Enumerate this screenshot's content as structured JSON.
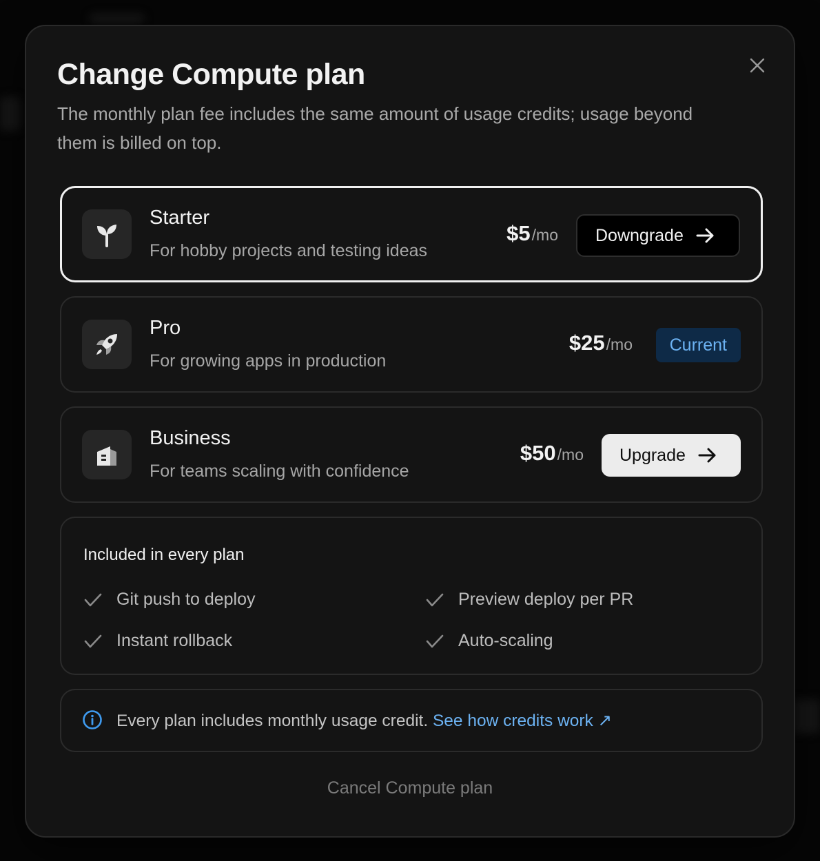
{
  "modal": {
    "title": "Change Compute plan",
    "subtitle": "The monthly plan fee includes the same amount of usage credits; usage beyond them is billed on top."
  },
  "plans": [
    {
      "name": "Starter",
      "description": "For hobby projects and testing ideas",
      "price": "$5",
      "period": "/mo",
      "action": "Downgrade",
      "icon": "sprout-icon",
      "selected": true
    },
    {
      "name": "Pro",
      "description": "For growing apps in production",
      "price": "$25",
      "period": "/mo",
      "action": "Current",
      "icon": "rocket-icon",
      "selected": false
    },
    {
      "name": "Business",
      "description": "For teams scaling with confidence",
      "price": "$50",
      "period": "/mo",
      "action": "Upgrade",
      "icon": "building-icon",
      "selected": false
    }
  ],
  "features": {
    "title": "Included in every plan",
    "items": [
      "Git push to deploy",
      "Preview deploy per PR",
      "Instant rollback",
      "Auto-scaling"
    ]
  },
  "info": {
    "text": "Every plan includes monthly usage credit.",
    "link": "See how credits work ↗"
  },
  "cancel_label": "Cancel Compute plan",
  "colors": {
    "accent": "#6cb2f2",
    "badge_bg": "#0e2a47",
    "modal_bg": "#141414"
  }
}
